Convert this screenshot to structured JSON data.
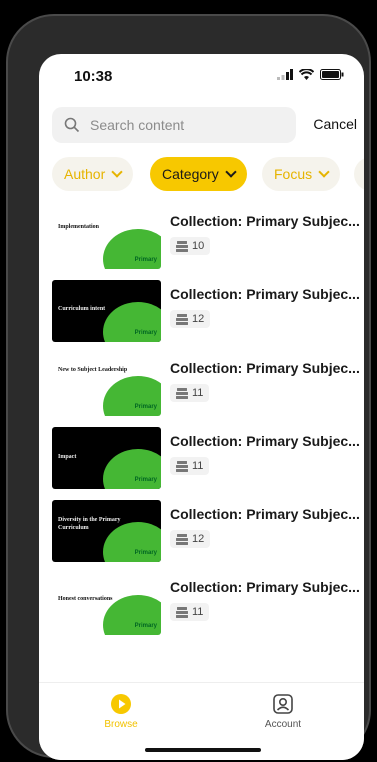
{
  "status_bar": {
    "time": "10:38"
  },
  "search": {
    "placeholder": "Search content",
    "cancel_label": "Cancel"
  },
  "filters": [
    {
      "label": "Author",
      "active": false
    },
    {
      "label": "Category",
      "active": true
    },
    {
      "label": "Focus",
      "active": false
    }
  ],
  "items": [
    {
      "thumb_title": "Implementation",
      "theme": "light",
      "title": "Collection: Primary Subjec...",
      "count": "10"
    },
    {
      "thumb_title": "Curriculum intent",
      "theme": "dark",
      "title": "Collection: Primary Subjec...",
      "count": "12"
    },
    {
      "thumb_title": "New to Subject Leadership",
      "theme": "light",
      "title": "Collection: Primary Subjec...",
      "count": "11"
    },
    {
      "thumb_title": "Impact",
      "theme": "dark",
      "title": "Collection: Primary Subjec...",
      "count": "11"
    },
    {
      "thumb_title": "Diversity in the Primary Curriculum",
      "theme": "dark",
      "title": "Collection: Primary Subjec...",
      "count": "12"
    },
    {
      "thumb_title": "Honest conversations",
      "theme": "light",
      "title": "Collection: Primary Subjec...",
      "count": "11"
    }
  ],
  "badge": {
    "text": "Primary"
  },
  "tabbar": {
    "browse_label": "Browse",
    "account_label": "Account"
  },
  "colors": {
    "accent": "#f7c800",
    "badge_green": "#45b734"
  }
}
